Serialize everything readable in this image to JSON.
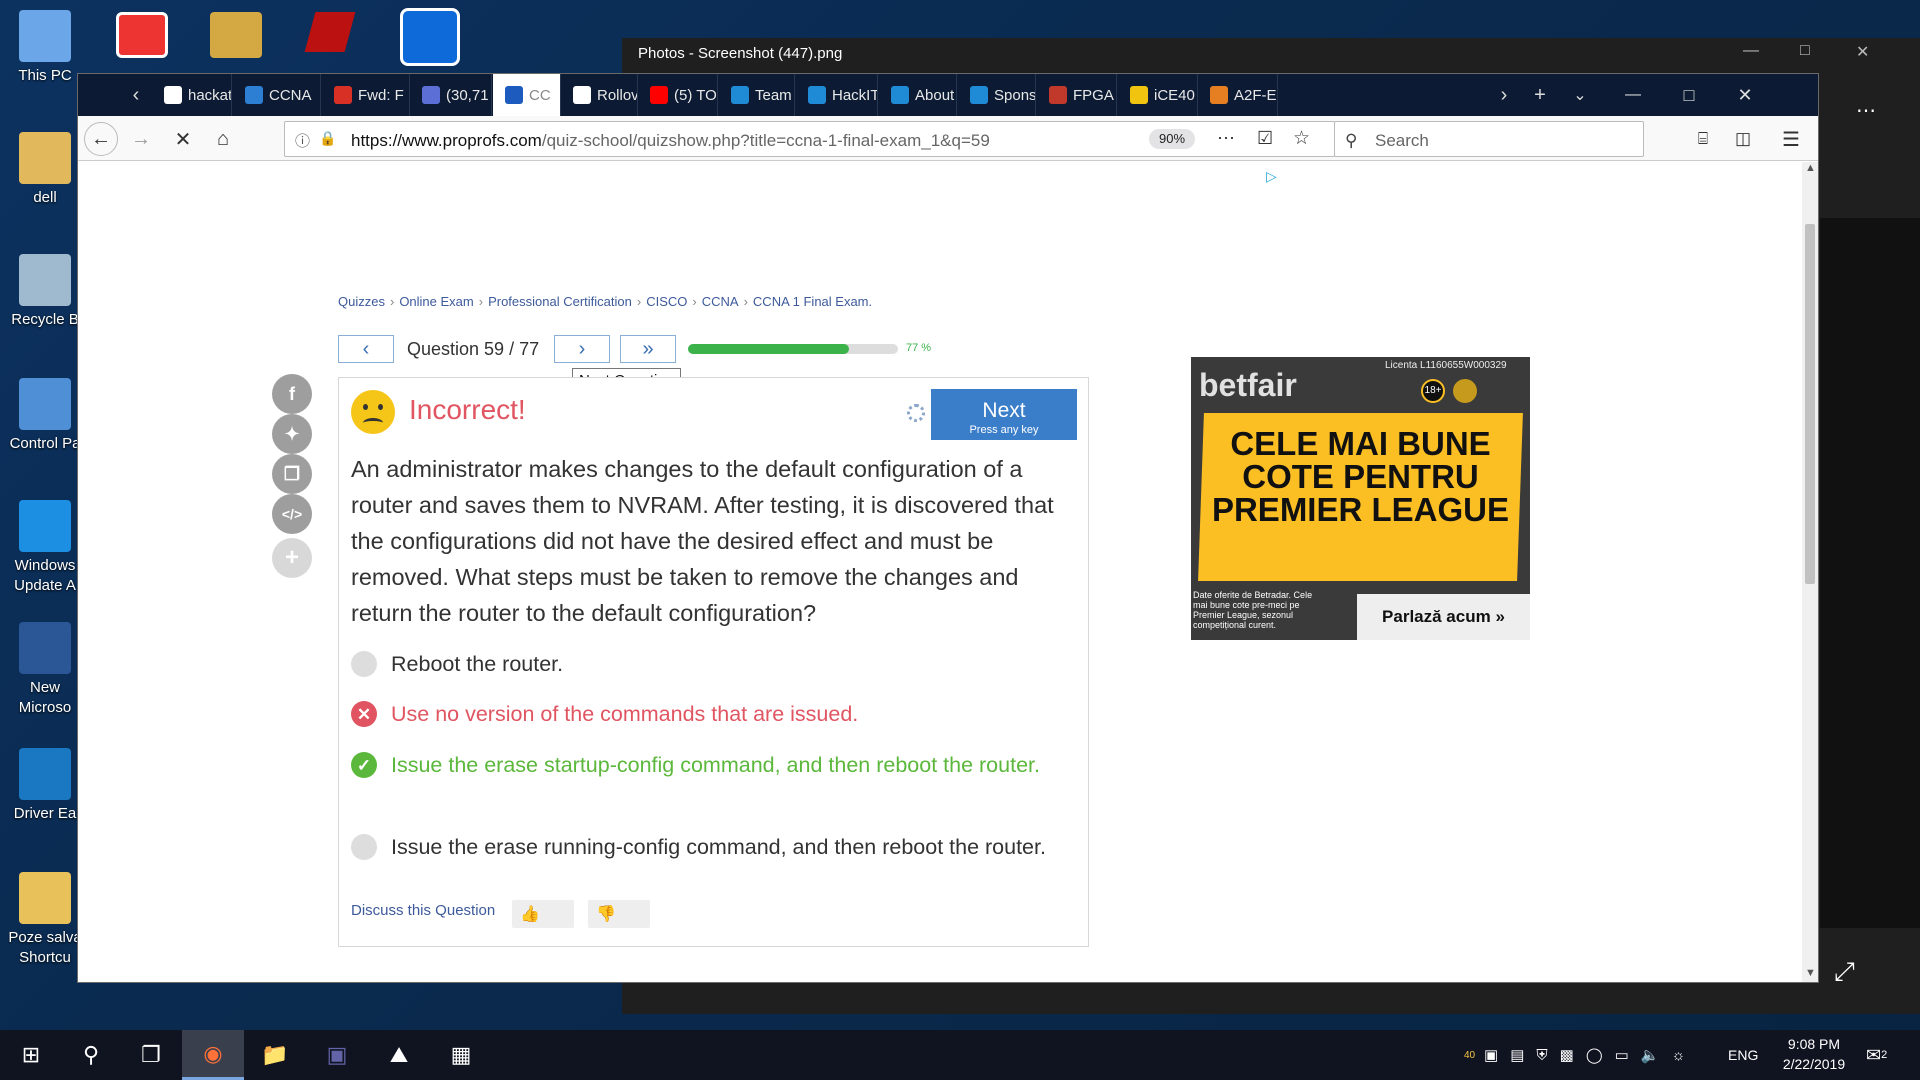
{
  "desktop": {
    "icons": [
      "This PC",
      "dell",
      "Recycle B",
      "Control Pa",
      "Windows\nUpdate A",
      "New\nMicroso",
      "Driver Ea",
      "Poze salva\nShortcu"
    ]
  },
  "photos": {
    "title": "Photos - Screenshot (447).png"
  },
  "browser": {
    "tabs": [
      {
        "label": "hackat",
        "icon": "google-icon",
        "color": "#ffffff"
      },
      {
        "label": "CCNA",
        "icon": "ccna-icon",
        "color": "#2d7fd3"
      },
      {
        "label": "Fwd: F",
        "icon": "gmail-icon",
        "color": "#d93025"
      },
      {
        "label": "(30,71",
        "icon": "flag-icon",
        "color": "#5b6fd6"
      },
      {
        "label": "CC",
        "icon": "proprofs-icon",
        "color": "#1e5bbf"
      },
      {
        "label": "Rollov",
        "icon": "wikipedia-icon",
        "color": "#ffffff"
      },
      {
        "label": "(5) TO",
        "icon": "youtube-icon",
        "color": "#ff0000"
      },
      {
        "label": "Team",
        "icon": "hackit-icon",
        "color": "#1f8ad6"
      },
      {
        "label": "HackIT",
        "icon": "hackit-icon",
        "color": "#1f8ad6"
      },
      {
        "label": "About",
        "icon": "hackit-icon",
        "color": "#1f8ad6"
      },
      {
        "label": "Spons",
        "icon": "hackit-icon",
        "color": "#1f8ad6"
      },
      {
        "label": "FPGA",
        "icon": "fpga-icon",
        "color": "#c0392b"
      },
      {
        "label": "iCE40",
        "icon": "lattice-icon",
        "color": "#f1c40f"
      },
      {
        "label": "A2F-E",
        "icon": "a2f-icon",
        "color": "#e67e22"
      }
    ],
    "url_host": "https://www.proprofs.com",
    "url_path": "/quiz-school/quizshow.php?title=ccna-1-final-exam_1&q=59",
    "zoom": "90%",
    "search_placeholder": "Search"
  },
  "page": {
    "breadcrumb": [
      "Quizzes",
      "Online Exam",
      "Professional Certification",
      "CISCO",
      "CCNA",
      "CCNA 1 Final Exam."
    ],
    "question_label": "Question 59 / 77",
    "progress_percent": 77,
    "progress_text": "77 %",
    "tooltip": "Next Question",
    "result": "Incorrect!",
    "next_label": "Next",
    "next_hint": "Press any key",
    "question": "An administrator makes changes to the default configuration of a router and saves them to NVRAM. After testing, it is discovered that the configurations did not have the desired effect and must be removed. What steps must be taken to remove the changes and return the router to the default configuration?",
    "options": [
      {
        "text": "Reboot the router.",
        "state": "neutral"
      },
      {
        "text": "Use no version of the commands that are issued.",
        "state": "wrong"
      },
      {
        "text": "Issue the erase startup-config command, and then reboot the router.",
        "state": "correct"
      },
      {
        "text": "Issue the erase running-config command, and then reboot the router.",
        "state": "neutral"
      }
    ],
    "discuss": "Discuss this Question",
    "colors": {
      "wrong": "#e05561",
      "correct": "#5cb83c",
      "accent": "#3a7dc9"
    }
  },
  "ad": {
    "brand": "betfair",
    "license": "Licenta L1160655W000329",
    "age_badge": "18+",
    "headline": "CELE MAI BUNE COTE PENTRU PREMIER LEAGUE",
    "small_print": "Date oferite de Betradar. Cele mai bune cote pre-meci pe Premier League, sezonul competițional curent.",
    "cta": "Parlază acum"
  },
  "taskbar": {
    "lang": "ENG",
    "time": "9:08 PM",
    "date": "2/22/2019",
    "notif_count": "2",
    "tray_badge": "40"
  }
}
